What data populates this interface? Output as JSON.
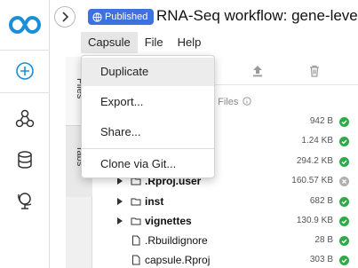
{
  "header": {
    "badge_label": "Published",
    "title": "RNA-Seq workflow: gene-level"
  },
  "menubar": {
    "items": [
      "Capsule",
      "File",
      "Help"
    ]
  },
  "dropdown": {
    "items": [
      "Duplicate",
      "Export...",
      "Share...",
      "Clone via Git..."
    ]
  },
  "side_tabs": [
    "Files",
    "Tabs"
  ],
  "files_header": "e Files",
  "rows": [
    {
      "name": "",
      "size": "942 B",
      "status": "ok"
    },
    {
      "name": "",
      "size": "1.24 KB",
      "status": "ok"
    },
    {
      "name": "",
      "size": "294.2 KB",
      "status": "ok"
    },
    {
      "name": ".Rproj.user",
      "size": "160.57 KB",
      "status": "excluded",
      "type": "folder"
    },
    {
      "name": "inst",
      "size": "682 B",
      "status": "ok",
      "type": "folder"
    },
    {
      "name": "vignettes",
      "size": "130.9 KB",
      "status": "ok",
      "type": "folder"
    },
    {
      "name": ".Rbuildignore",
      "size": "28 B",
      "status": "ok",
      "type": "file"
    },
    {
      "name": "capsule.Rproj",
      "size": "303 B",
      "status": "ok",
      "type": "file"
    }
  ],
  "colors": {
    "brand": "#1a8fd6",
    "badge": "#3c72de",
    "status_ok": "#2eaa46"
  },
  "icons": [
    "codeocean-logo-icon",
    "add-icon",
    "collaborate-icon",
    "database-icon",
    "explore-icon",
    "collapse-chevron-icon",
    "globe-icon",
    "upload-icon",
    "trash-icon",
    "info-icon",
    "folder-icon",
    "file-icon",
    "caret-right-icon",
    "check-icon",
    "close-icon"
  ]
}
